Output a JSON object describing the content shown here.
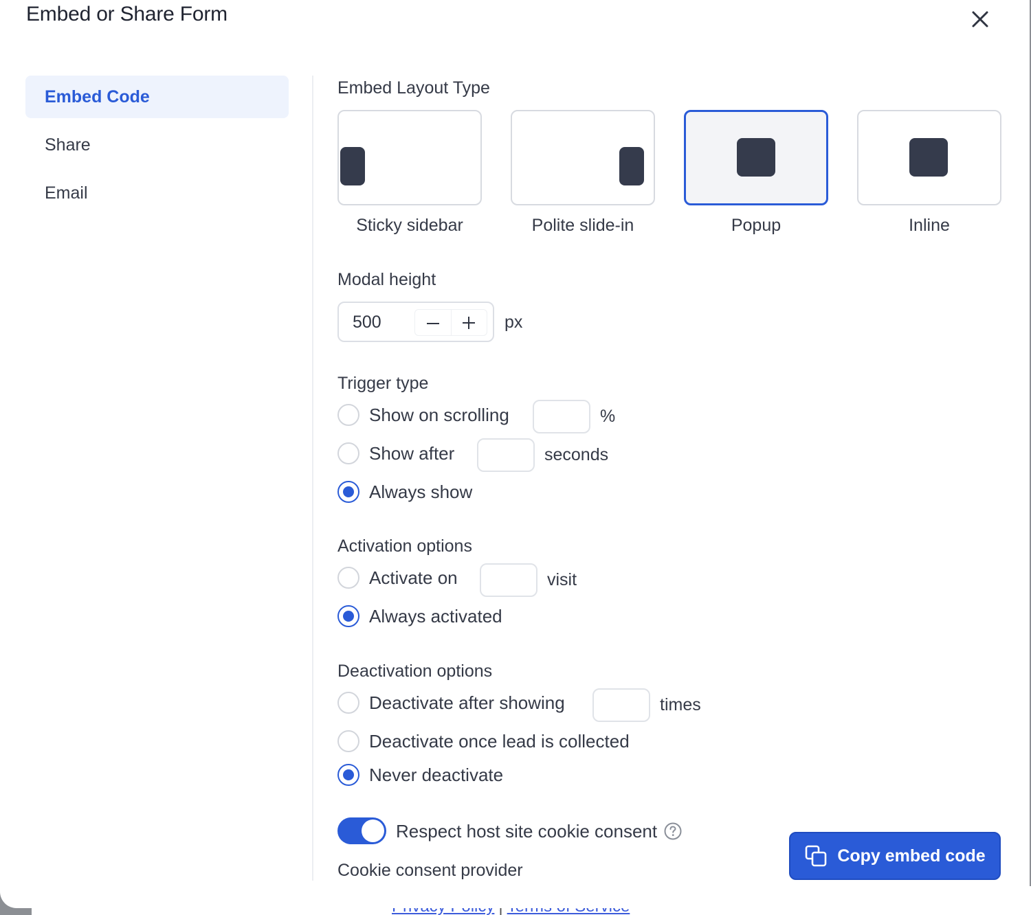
{
  "modal": {
    "title": "Embed or Share Form"
  },
  "nav": {
    "items": [
      {
        "label": "Embed Code",
        "active": true
      },
      {
        "label": "Share",
        "active": false
      },
      {
        "label": "Email",
        "active": false
      }
    ]
  },
  "layout": {
    "section_label": "Embed Layout Type",
    "options": [
      {
        "label": "Sticky sidebar",
        "selected": false
      },
      {
        "label": "Polite slide-in",
        "selected": false
      },
      {
        "label": "Popup",
        "selected": true
      },
      {
        "label": "Inline",
        "selected": false
      }
    ]
  },
  "modal_height": {
    "label": "Modal height",
    "value": "500",
    "unit": "px"
  },
  "trigger": {
    "label": "Trigger type",
    "show_on_scrolling": {
      "label": "Show on scrolling",
      "unit": "%",
      "value": ""
    },
    "show_after": {
      "label": "Show after",
      "unit": "seconds",
      "value": ""
    },
    "always_show": {
      "label": "Always show"
    },
    "selected": "always_show"
  },
  "activation": {
    "label": "Activation options",
    "activate_on": {
      "label": "Activate on",
      "unit": "visit",
      "value": ""
    },
    "always_activated": {
      "label": "Always activated"
    },
    "selected": "always_activated"
  },
  "deactivation": {
    "label": "Deactivation options",
    "after_showing": {
      "label": "Deactivate after showing",
      "unit": "times",
      "value": ""
    },
    "once_lead": {
      "label": "Deactivate once lead is collected"
    },
    "never": {
      "label": "Never deactivate"
    },
    "selected": "never"
  },
  "cookie": {
    "toggle_label": "Respect host site cookie consent",
    "toggle_on": true,
    "provider_label": "Cookie consent provider"
  },
  "actions": {
    "copy_label": "Copy embed code"
  },
  "footer": {
    "privacy": "Privacy Policy",
    "separator": "|",
    "terms": "Terms of Service"
  },
  "colors": {
    "accent": "#2a5bd7",
    "nav_active_bg": "#eef3fd"
  }
}
